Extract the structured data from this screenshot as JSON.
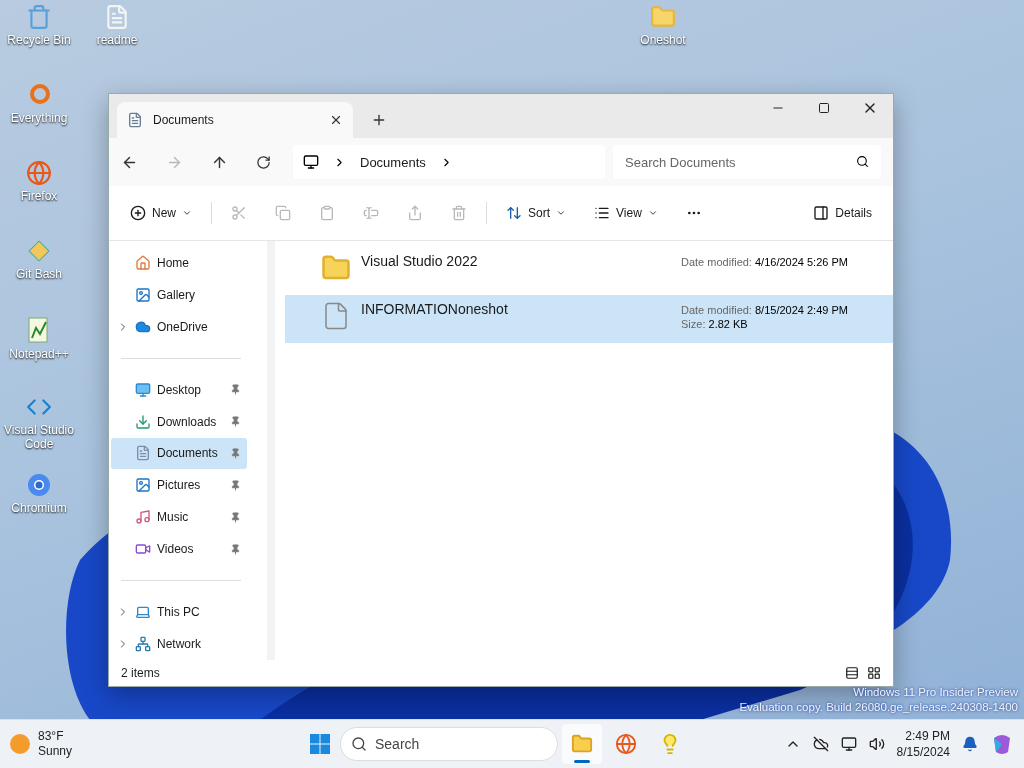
{
  "desktop_icons": [
    {
      "label": "Recycle Bin",
      "kind": "recycle"
    },
    {
      "label": "readme",
      "kind": "document"
    },
    {
      "label": "Oneshot",
      "kind": "folder"
    },
    {
      "label": "Everything",
      "kind": "search-app"
    },
    {
      "label": "Firefox",
      "kind": "browser"
    },
    {
      "label": "Git Bash",
      "kind": "diamond"
    },
    {
      "label": "Notepad++",
      "kind": "notepad"
    },
    {
      "label": "Visual Studio Code",
      "kind": "code"
    },
    {
      "label": "Chromium",
      "kind": "chromium"
    }
  ],
  "window": {
    "tab": {
      "title": "Documents"
    },
    "address": {
      "crumbs": [
        "Documents"
      ]
    },
    "search": {
      "placeholder": "Search Documents"
    },
    "toolbar": [
      {
        "kind": "new",
        "label": "New",
        "disabled": false
      },
      {
        "kind": "cut",
        "disabled": true
      },
      {
        "kind": "copy",
        "disabled": true
      },
      {
        "kind": "paste",
        "disabled": true
      },
      {
        "kind": "rename",
        "disabled": true
      },
      {
        "kind": "share",
        "disabled": true
      },
      {
        "kind": "delete",
        "disabled": true
      },
      {
        "kind": "sort",
        "label": "Sort",
        "disabled": false
      },
      {
        "kind": "view",
        "label": "View",
        "disabled": false
      },
      {
        "kind": "more",
        "disabled": false
      }
    ],
    "details_button": {
      "label": "Details"
    },
    "sidebar": {
      "groups": [
        [
          {
            "label": "Home",
            "kind": "home",
            "expandable": false,
            "pinned": false,
            "selected": false
          },
          {
            "label": "Gallery",
            "kind": "gallery",
            "expandable": false,
            "pinned": false,
            "selected": false
          },
          {
            "label": "OneDrive",
            "kind": "cloud",
            "expandable": true,
            "pinned": false,
            "selected": false
          }
        ],
        [
          {
            "label": "Desktop",
            "kind": "desktop",
            "expandable": false,
            "pinned": true,
            "selected": false
          },
          {
            "label": "Downloads",
            "kind": "downloads",
            "expandable": false,
            "pinned": true,
            "selected": false
          },
          {
            "label": "Documents",
            "kind": "documents",
            "expandable": false,
            "pinned": true,
            "selected": true
          },
          {
            "label": "Pictures",
            "kind": "pictures",
            "expandable": false,
            "pinned": true,
            "selected": false
          },
          {
            "label": "Music",
            "kind": "music",
            "expandable": false,
            "pinned": true,
            "selected": false
          },
          {
            "label": "Videos",
            "kind": "videos",
            "expandable": false,
            "pinned": true,
            "selected": false
          }
        ],
        [
          {
            "label": "This PC",
            "kind": "pc",
            "expandable": true,
            "pinned": false,
            "selected": false
          },
          {
            "label": "Network",
            "kind": "network",
            "expandable": true,
            "pinned": false,
            "selected": false
          }
        ]
      ]
    },
    "files": [
      {
        "name": "Visual Studio 2022",
        "kind": "folder",
        "date_label": "Date modified:",
        "date": "4/16/2024 5:26 PM",
        "selected": false
      },
      {
        "name": "INFORMATIONoneshot",
        "kind": "text",
        "date_label": "Date modified:",
        "date": "8/15/2024 2:49 PM",
        "size_label": "Size:",
        "size": "2.82 KB",
        "selected": true
      }
    ],
    "status": "2 items"
  },
  "watermark": [
    "Windows 11 Pro Insider Preview",
    "Evaluation copy. Build 26080.ge_release.240308-1400"
  ],
  "taskbar": {
    "weather": {
      "temperature": "83°F",
      "condition": "Sunny"
    },
    "search": {
      "label": "Search"
    },
    "apps": [
      {
        "kind": "explorer",
        "active": true
      },
      {
        "kind": "browser",
        "active": false
      },
      {
        "kind": "bulb",
        "active": false
      }
    ],
    "clock": {
      "time": "2:49 PM",
      "date": "8/15/2024"
    }
  }
}
